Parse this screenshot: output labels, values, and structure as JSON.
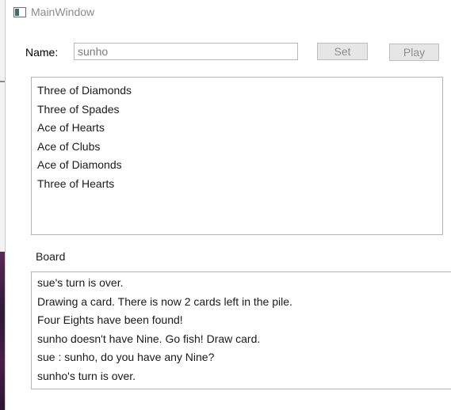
{
  "window": {
    "title": "MainWindow"
  },
  "form": {
    "name_label": "Name:",
    "name_value": "sunho",
    "set_label": "Set",
    "play_label": "Play"
  },
  "hand": {
    "items": [
      "Three of Diamonds",
      "Three of Spades",
      "Ace of Hearts",
      "Ace of Clubs",
      "Ace of Diamonds",
      "Three of Hearts"
    ]
  },
  "board": {
    "label": "Board",
    "messages": [
      "sue's turn is over.",
      "Drawing a card. There is now 2 cards left in the pile.",
      "Four Eights have been found!",
      "sunho doesn't have Nine. Go fish! Draw card.",
      "sue : sunho, do you have any Nine?",
      "sunho's turn is over."
    ]
  },
  "colors": {
    "backdrop_purple": "#4a1f47",
    "window_bg": "#ffffff",
    "disabled_text": "#8e8e8e",
    "border": "#b4b4b4"
  }
}
